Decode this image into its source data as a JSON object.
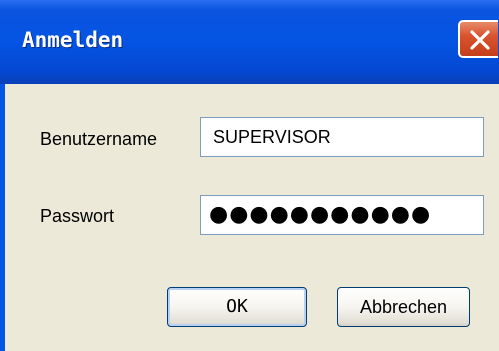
{
  "window": {
    "title": "Anmelden",
    "close_icon": "close-icon"
  },
  "form": {
    "username_label": "Benutzername",
    "username_value": "SUPERVISOR",
    "password_label": "Passwort",
    "password_value": "●●●●●●●●●●●"
  },
  "buttons": {
    "ok_label": "OK",
    "cancel_label": "Abbrechen"
  },
  "colors": {
    "titlebar": "#0554e3",
    "close_button": "#d9542e",
    "dialog_background": "#ece9d8"
  }
}
